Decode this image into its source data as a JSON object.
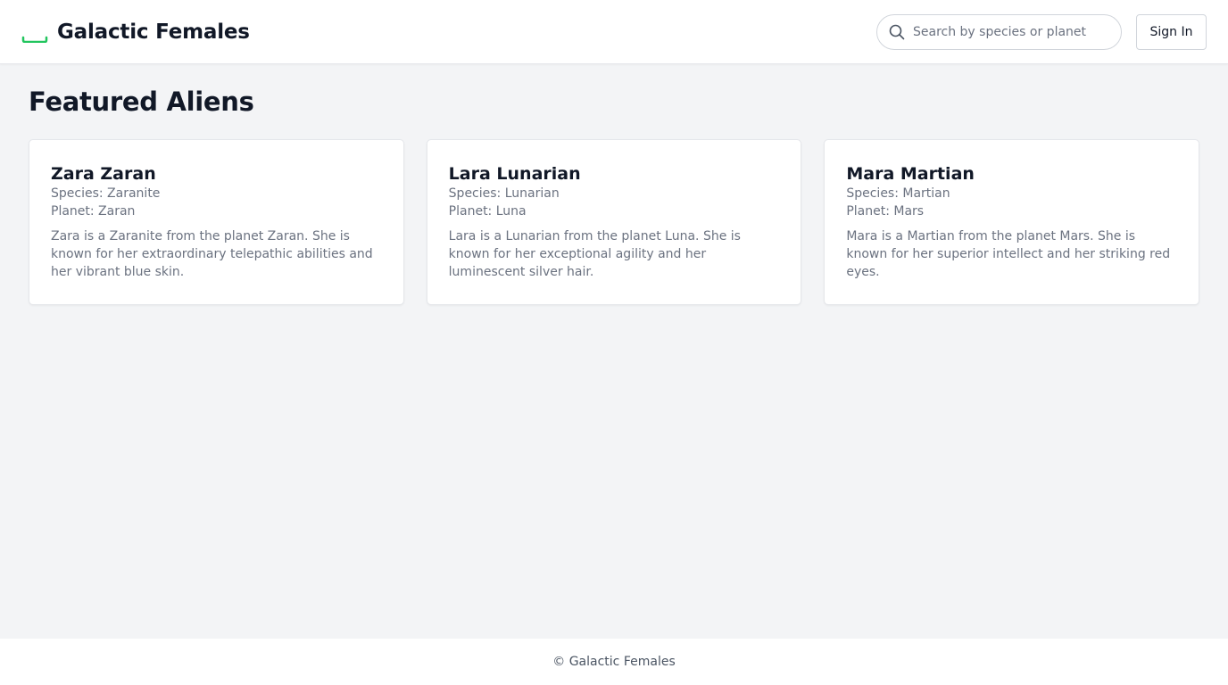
{
  "header": {
    "brand_title": "Galactic Females",
    "logo_icon": "green-underscore-logo",
    "accent_color": "#22c55e",
    "search": {
      "placeholder": "Search by species or planet",
      "value": "",
      "icon": "search-icon"
    },
    "sign_in_label": "Sign In"
  },
  "main": {
    "title": "Featured Aliens",
    "cards": [
      {
        "name": "Zara Zaran",
        "species": "Species: Zaranite",
        "planet": "Planet: Zaran",
        "description": "Zara is a Zaranite from the planet Zaran. She is known for her extraordinary telepathic abilities and her vibrant blue skin."
      },
      {
        "name": "Lara Lunarian",
        "species": "Species: Lunarian",
        "planet": "Planet: Luna",
        "description": "Lara is a Lunarian from the planet Luna. She is known for her exceptional agility and her luminescent silver hair."
      },
      {
        "name": "Mara Martian",
        "species": "Species: Martian",
        "planet": "Planet: Mars",
        "description": "Mara is a Martian from the planet Mars. She is known for her superior intellect and her striking red eyes."
      }
    ]
  },
  "footer": {
    "text": "© Galactic Females"
  }
}
